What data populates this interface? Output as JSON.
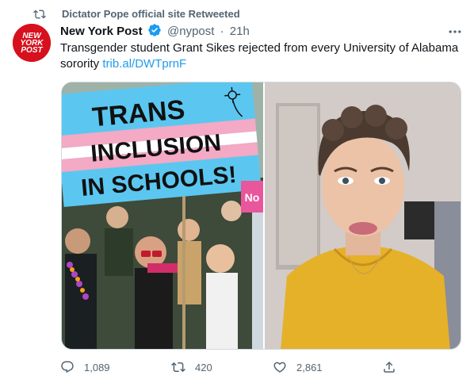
{
  "retweet_banner": {
    "icon": "retweet-icon",
    "text": "Dictator Pope official site Retweeted"
  },
  "author": {
    "avatar_logo": {
      "line1": "NEW",
      "line2": "YORK",
      "line3": "POST"
    },
    "name": "New York Post",
    "verified_icon": "verified-badge-icon",
    "handle": "@nypost",
    "separator": "·",
    "time": "21h"
  },
  "tweet": {
    "text": "Transgender student Grant Sikes rejected from every University of Alabama sorority",
    "link": "trib.al/DWTprnF"
  },
  "media": {
    "left_image": {
      "description_icon": "protest-sign-image",
      "sign_lines": [
        "TRANS",
        "INCLUSION",
        "IN SCHOOLS!"
      ],
      "side_sign": "No"
    },
    "right_image": {
      "description_icon": "portrait-photo-image"
    }
  },
  "actions": {
    "reply": {
      "icon": "reply-icon",
      "count": "1,089"
    },
    "retweet": {
      "icon": "retweet-icon",
      "count": "420"
    },
    "like": {
      "icon": "heart-icon",
      "count": "2,861"
    },
    "share": {
      "icon": "share-icon"
    }
  },
  "colors": {
    "accent": "#1d9bf0",
    "secondary_text": "#536471",
    "brand_red": "#d6111d"
  }
}
